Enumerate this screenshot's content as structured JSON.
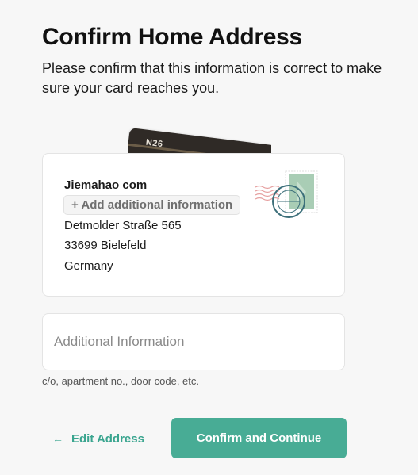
{
  "page": {
    "title": "Confirm Home Address",
    "subtitle": "Please confirm that this information is correct to make sure your card reaches you."
  },
  "card_visual": {
    "logo_text": "N26"
  },
  "address": {
    "name": "Jiemahao com",
    "add_info_label": "+ Add additional information",
    "street": "Detmolder Straße 565",
    "city_line": "33699 Bielefeld",
    "country": "Germany",
    "stamp_icon": "postage-stamp-icon"
  },
  "additional_field": {
    "placeholder": "Additional Information",
    "value": "",
    "hint": "c/o, apartment no., door code, etc."
  },
  "actions": {
    "edit_label": "Edit Address",
    "edit_icon": "arrow-left-icon",
    "confirm_label": "Confirm and Continue"
  },
  "colors": {
    "accent": "#48ac95",
    "accent_text": "#3aa58f",
    "background": "#f7f7f7",
    "card_dark": "#2f2a26",
    "stamp_green": "#a9cdb5",
    "postmark": "#3c6f7a"
  }
}
